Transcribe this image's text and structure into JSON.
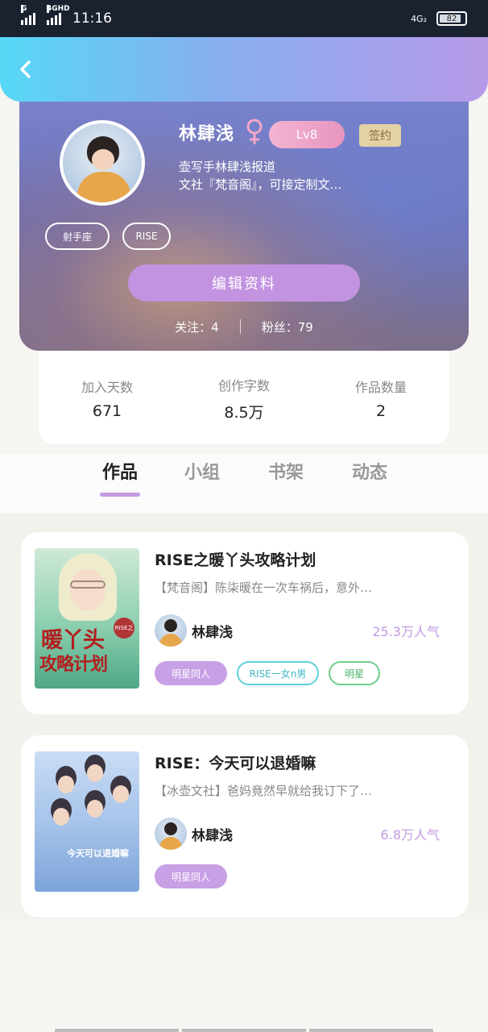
{
  "status_bar": {
    "signal1": "G",
    "signal2": "4GHD",
    "time": "11:16",
    "network": "4G₂",
    "battery": "82"
  },
  "profile": {
    "name": "林肆浅",
    "level": "Lv8",
    "sign_badge": "签约",
    "bio_line1": "壶写手林肆浅报道",
    "bio_line2": "文社『梵音阁』，可接定制文…",
    "tags": [
      "射手座",
      "RISE"
    ],
    "edit_label": "编辑资料",
    "follow_label": "关注：4",
    "fans_label": "粉丝：79"
  },
  "stats": [
    {
      "label": "加入天数",
      "value": "671"
    },
    {
      "label": "创作字数",
      "value": "8.5万"
    },
    {
      "label": "作品数量",
      "value": "2"
    }
  ],
  "tabs": [
    "作品",
    "小组",
    "书架",
    "动态"
  ],
  "works": [
    {
      "title": "RISE之暖丫头攻略计划",
      "desc": "【梵音阁】陈柒暖在一次车祸后，意外…",
      "author": "林肆浅",
      "popularity": "25.3万人气",
      "cover_title1": "暖丫头",
      "cover_title2": "攻略计划",
      "cover_seal": "RISE之",
      "chips": [
        "明星同人",
        "RISE一女n男",
        "明星"
      ]
    },
    {
      "title": "RISE：今天可以退婚嘛",
      "desc": "【冰壶文社】爸妈竟然早就给我订下了…",
      "author": "林肆浅",
      "popularity": "6.8万人气",
      "cover_title": "今天可以退婚嘛",
      "chips": [
        "明星同人"
      ]
    }
  ],
  "colors": {
    "accent_purple": "#c39ae3",
    "header_gradient_start": "#56d8f5",
    "header_gradient_end": "#b79ae8",
    "sign_badge": "#e4d2a6"
  }
}
